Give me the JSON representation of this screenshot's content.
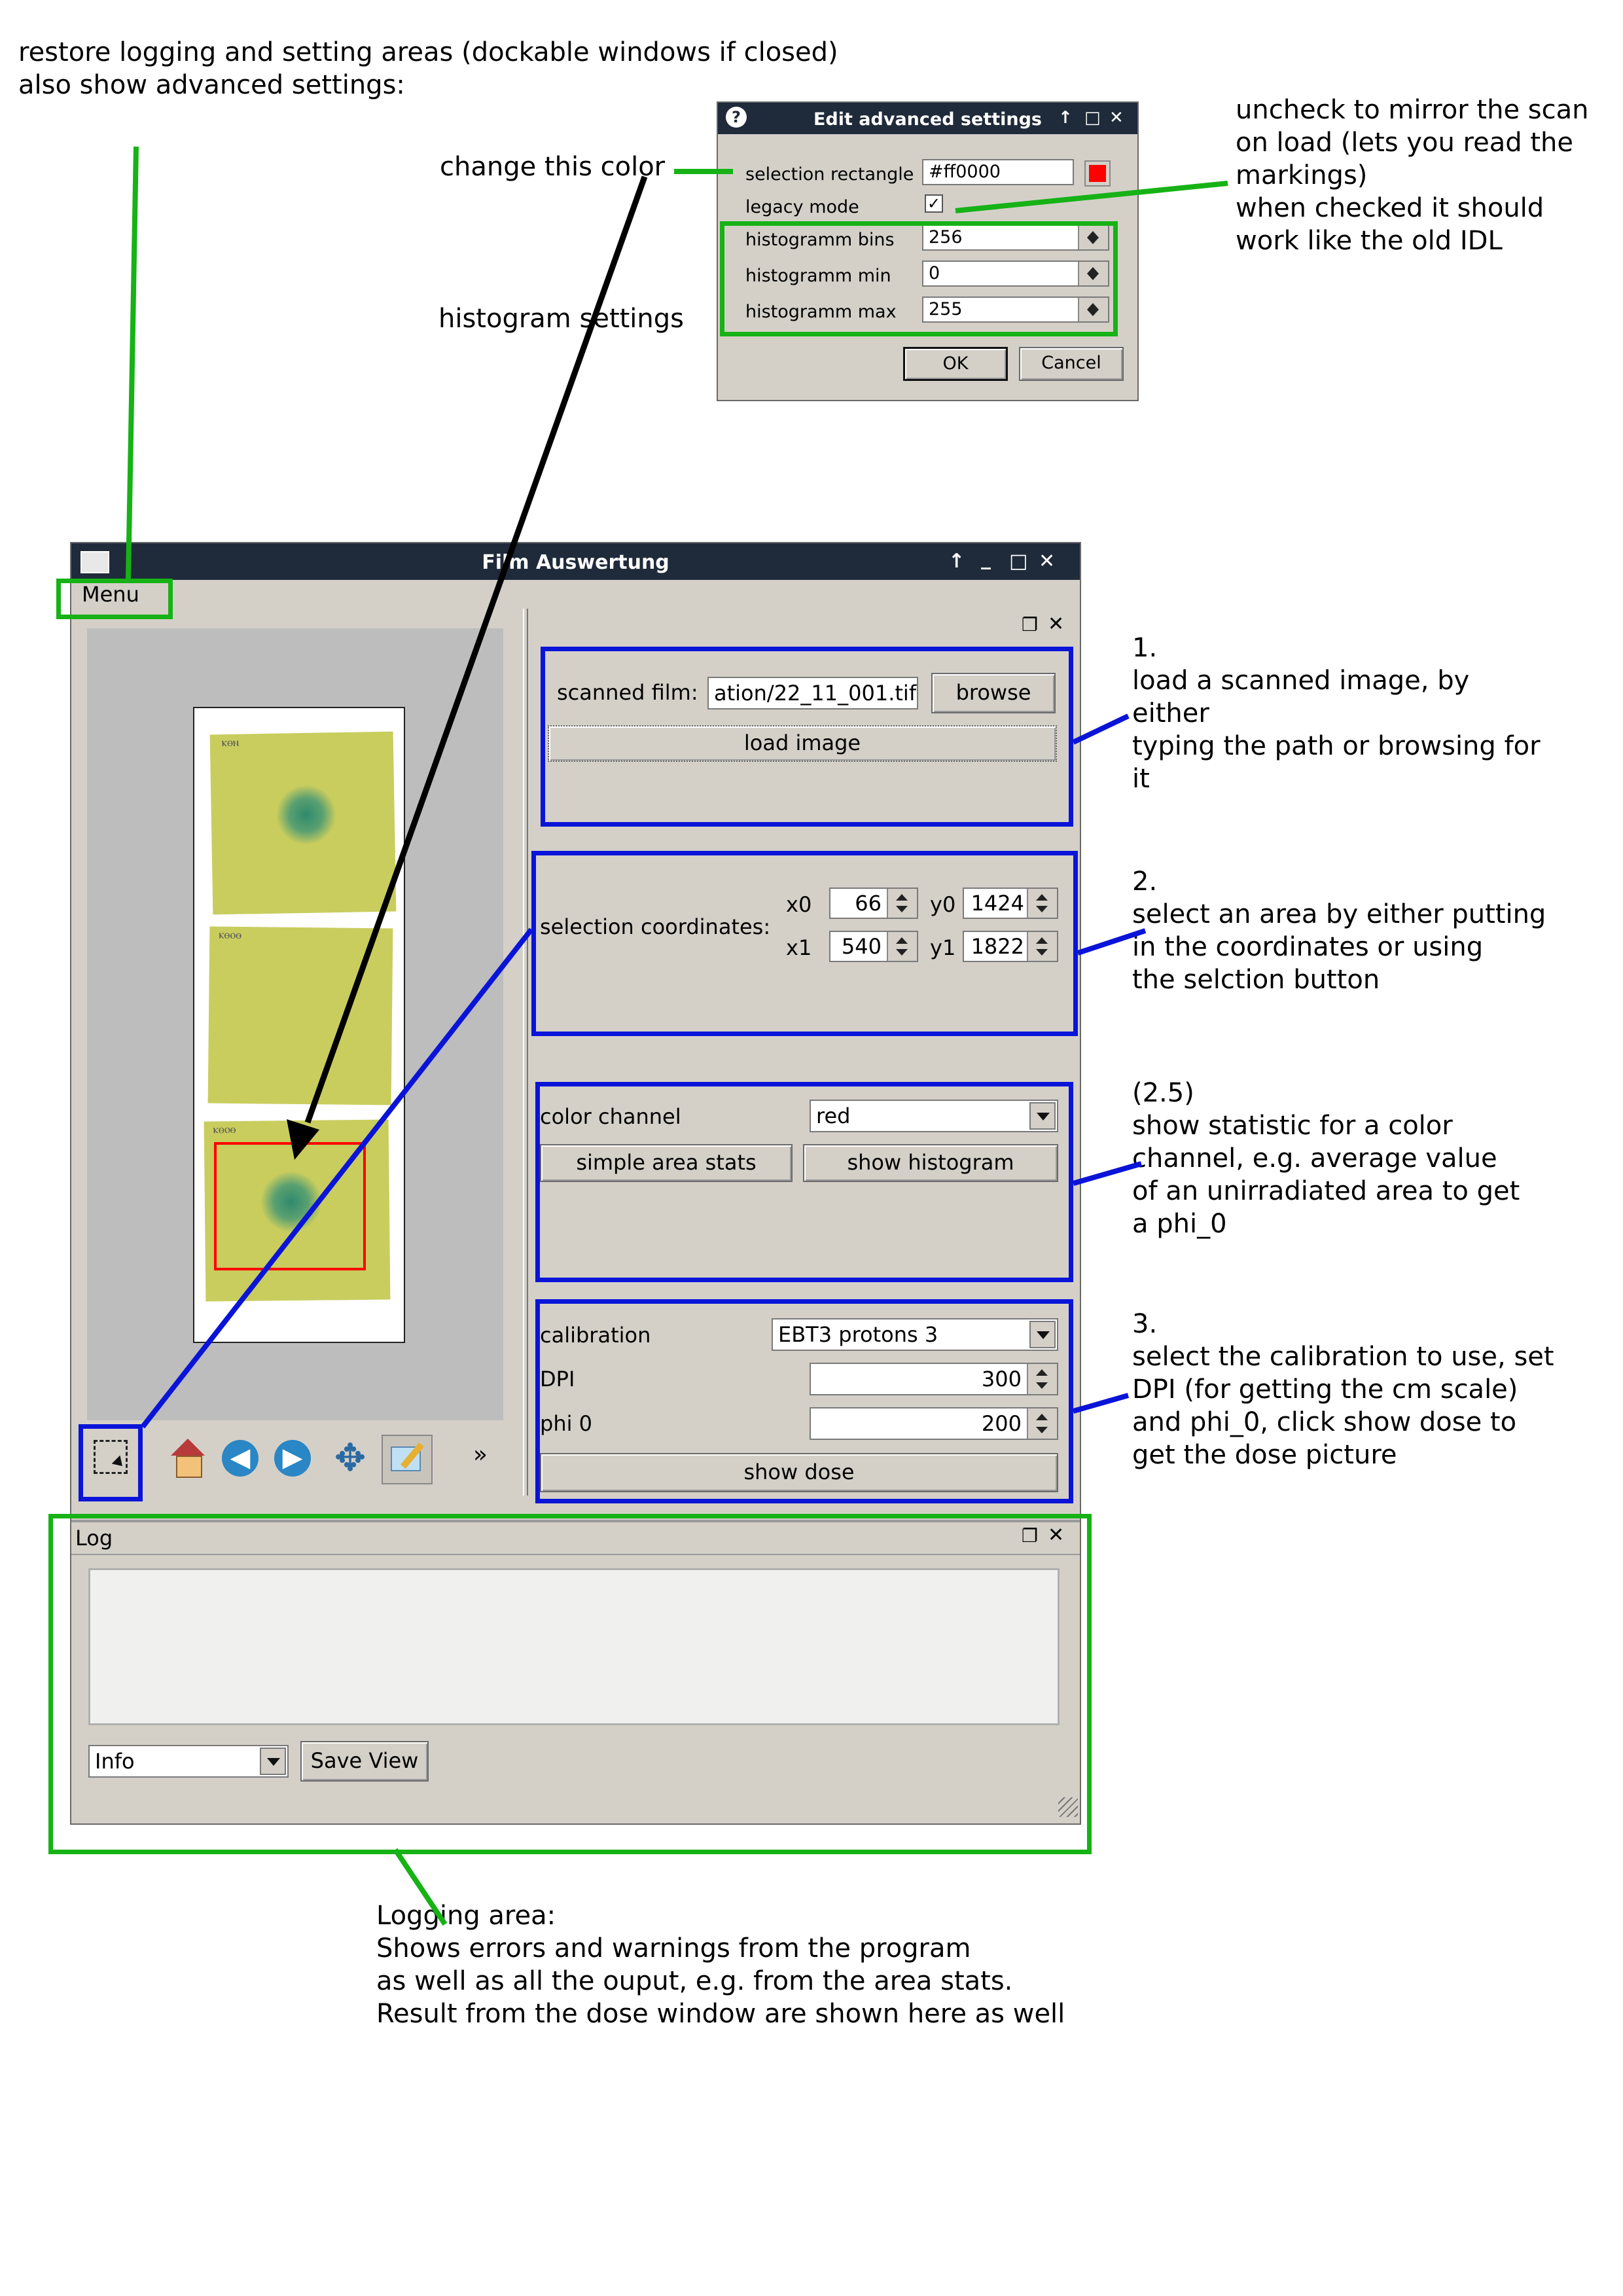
{
  "annotations": {
    "top_left": "restore logging and setting areas (dockable windows if closed)\nalso show advanced settings:",
    "change_color": "change this color",
    "histogram_settings": "histogram settings",
    "legacy_note": "uncheck to mirror the scan\non load (lets you read the\nmarkings)\nwhen checked it should\nwork like the old IDL",
    "step1": "1.\nload a scanned image, by\neither\ntyping the path or browsing for\nit",
    "step2": "2.\nselect an area by either putting\nin the coordinates or using\nthe selction button",
    "step25": "(2.5)\nshow statistic for a color\nchannel, e.g. average value\nof an unirradiated area to get\na phi_0",
    "step3": "3.\nselect the calibration to use, set\nDPI (for getting the cm scale)\nand phi_0, click show dose to\nget the dose picture",
    "logging": "Logging area:\nShows errors and warnings from the program\nas well as all the ouput, e.g. from the area stats.\nResult from the dose window are shown here as well"
  },
  "dialog": {
    "title": "Edit advanced settings",
    "title_buttons": [
      "↑",
      "□",
      "✕"
    ],
    "selection_rectangle_label": "selection rectangle",
    "selection_rectangle_value": "#ff0000",
    "selection_color": "#ff0000",
    "legacy_mode_label": "legacy mode",
    "legacy_checked": true,
    "bins_label": "histogramm bins",
    "bins_value": "256",
    "min_label": "histogramm min",
    "min_value": "0",
    "max_label": "histogramm max",
    "max_value": "255",
    "ok": "OK",
    "cancel": "Cancel"
  },
  "main": {
    "title": "Film Auswertung",
    "title_buttons": [
      "↑",
      "_",
      "□",
      "✕"
    ],
    "menu": "Menu",
    "dock_buttons": [
      "❐",
      "✕"
    ],
    "scanned_film_label": "scanned film:",
    "scanned_film_value": "ation/22_11_001.tif",
    "browse": "browse",
    "load_image": "load image",
    "selection_coordinates_label": "selection coordinates:",
    "x0_label": "x0",
    "x0": "66",
    "y0_label": "y0",
    "y0": "1424",
    "x1_label": "x1",
    "x1": "540",
    "y1_label": "y1",
    "y1": "1822",
    "color_channel_label": "color channel",
    "color_channel_value": "red",
    "simple_area_stats": "simple area stats",
    "show_histogram": "show histogram",
    "calibration_label": "calibration",
    "calibration_value": "EBT3 protons 3",
    "dpi_label": "DPI",
    "dpi_value": "300",
    "phi0_label": "phi 0",
    "phi0_value": "200",
    "show_dose": "show dose",
    "film_marks": [
      "ⲕⲑⲛ",
      "ⲕⲑⲟⲑ",
      "ⲕⲑⲟⲑ"
    ],
    "toolbar_more": "»"
  },
  "log": {
    "title": "Log",
    "dock_buttons": [
      "❐",
      "✕"
    ],
    "level_value": "Info",
    "save_view": "Save View"
  },
  "colors": {
    "annotation_green": "#16b216",
    "annotation_blue": "#0a14d8",
    "film": "#c9cd5e",
    "spot": "#3a8a6a",
    "titlebar": "#1f2a3a"
  }
}
